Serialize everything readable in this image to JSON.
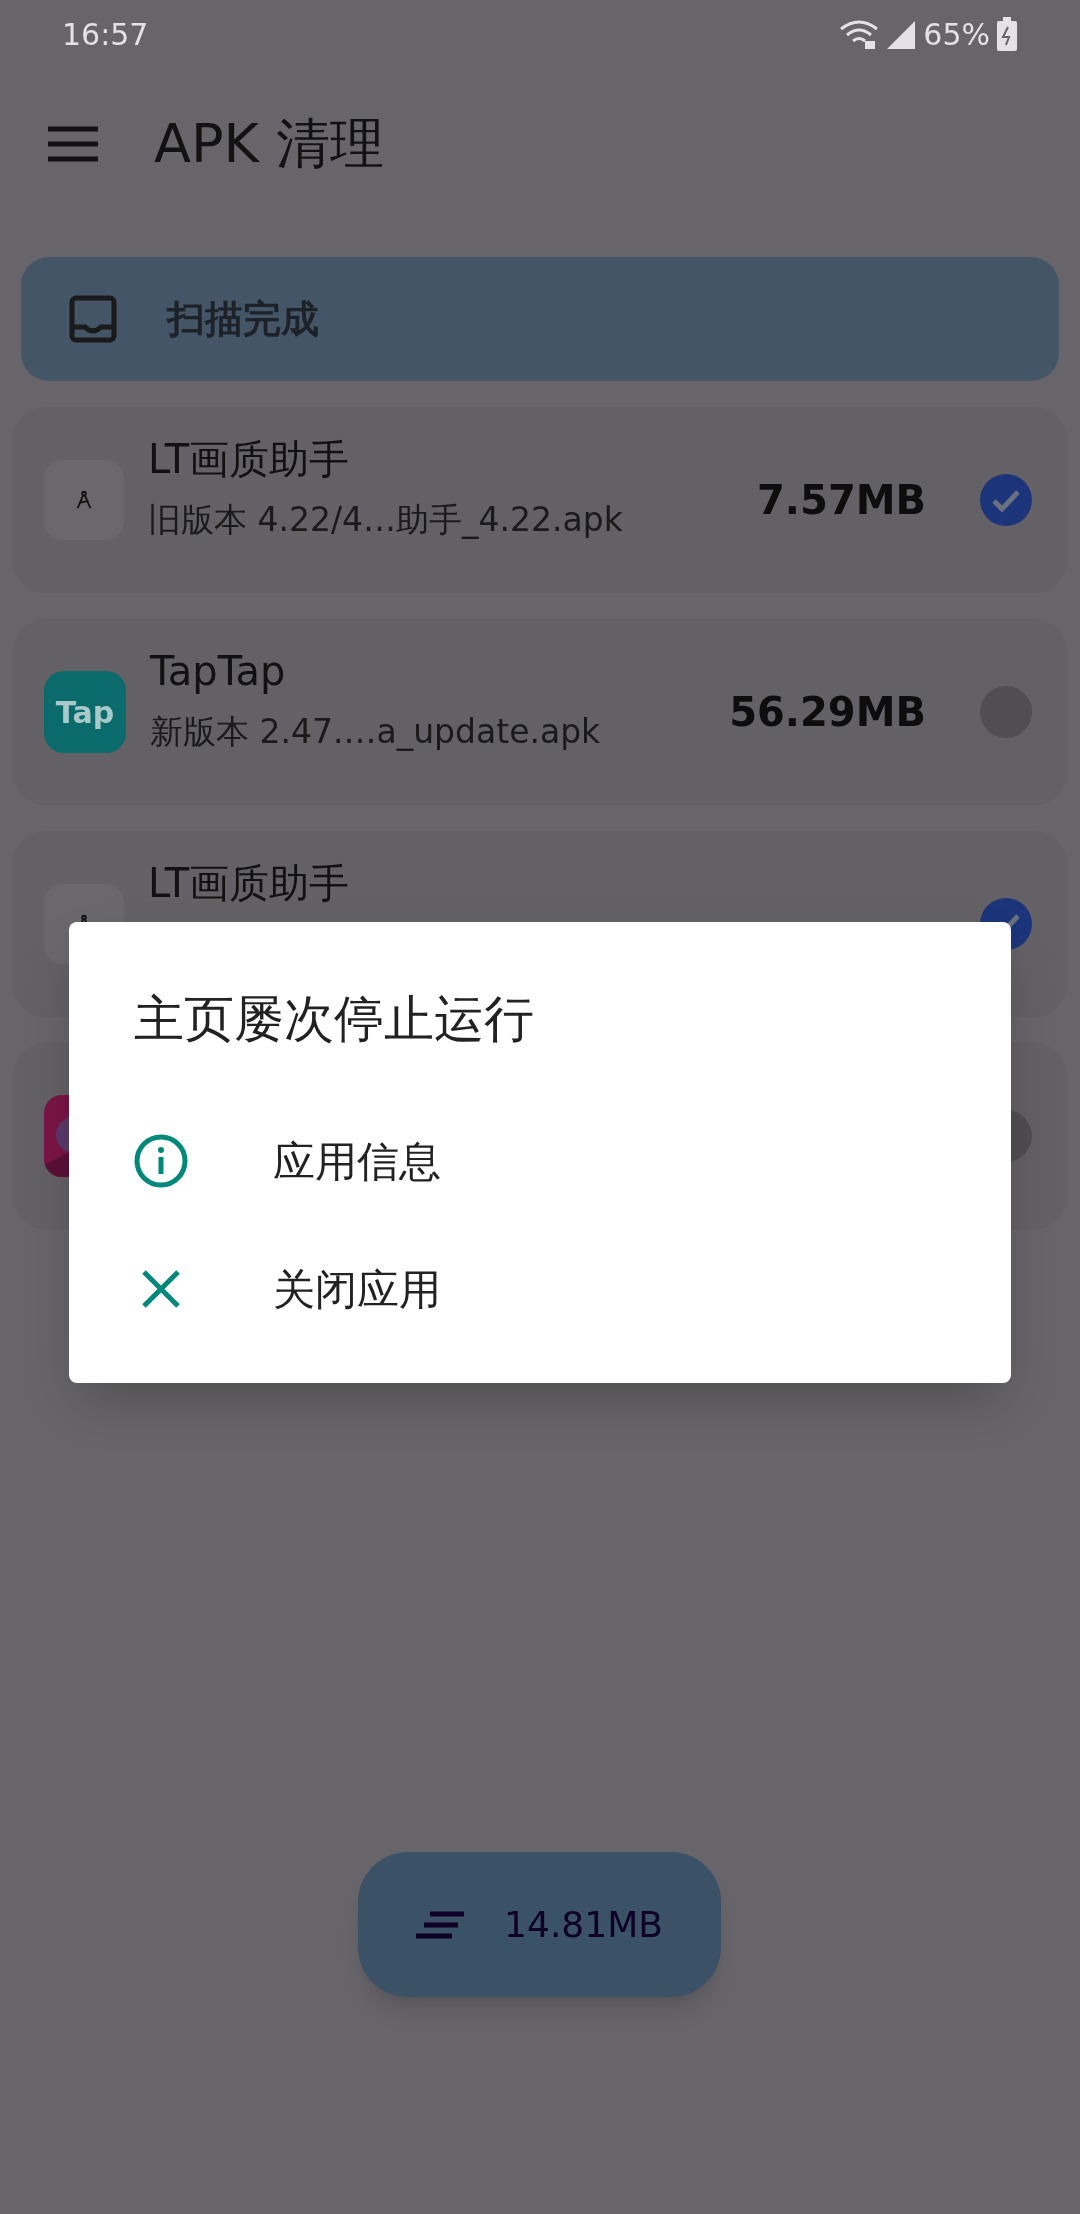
{
  "status_bar": {
    "time": "16:57",
    "battery": "65%"
  },
  "toolbar": {
    "title": "APK 清理"
  },
  "banner": {
    "text": "扫描完成"
  },
  "items": [
    {
      "icon": {
        "kind": "compass"
      },
      "name": "LT画质助手",
      "detail": "旧版本 4.22/4…助手_4.22.apk",
      "size": "7.57MB",
      "selected": true
    },
    {
      "icon": {
        "kind": "logo",
        "label": "Tap"
      },
      "name": "TapTap",
      "detail": "新版本 2.47.…a_update.apk",
      "size": "56.29MB",
      "selected": false
    },
    {
      "icon": {
        "kind": "compass"
      },
      "name": "LT画质助手",
      "selected": true
    },
    {
      "selected": false
    }
  ],
  "dialog": {
    "title": "主页屡次停止运行",
    "options": [
      {
        "kind": "info",
        "label": "应用信息"
      },
      {
        "kind": "close",
        "label": "关闭应用"
      }
    ]
  },
  "fab": {
    "label": "14.81MB"
  }
}
